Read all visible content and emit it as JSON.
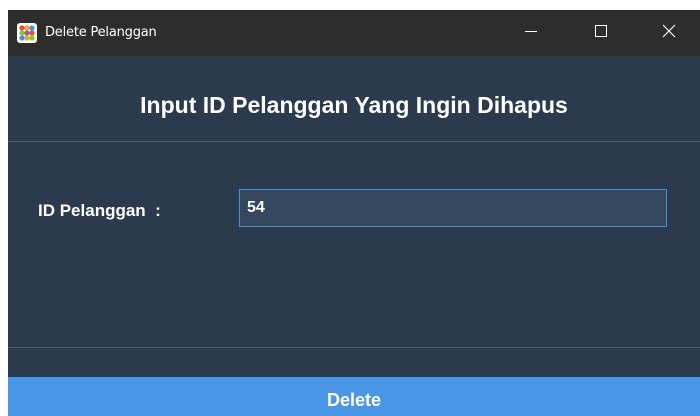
{
  "window": {
    "title": "Delete Pelanggan",
    "icon": "app-dots-icon",
    "controls": {
      "minimize": "minimize-icon",
      "maximize": "maximize-icon",
      "close": "close-icon"
    }
  },
  "form": {
    "heading": "Input ID Pelanggan Yang Ingin Dihapus",
    "id_label": "ID Pelanggan  :",
    "id_value": "54"
  },
  "actions": {
    "delete_label": "Delete"
  },
  "colors": {
    "background": "#2b3b4d",
    "titlebar": "#2d2d2e",
    "input_background": "#34475e",
    "input_border": "#4a90d9",
    "button": "#4a97e6",
    "text": "#ffffff"
  }
}
